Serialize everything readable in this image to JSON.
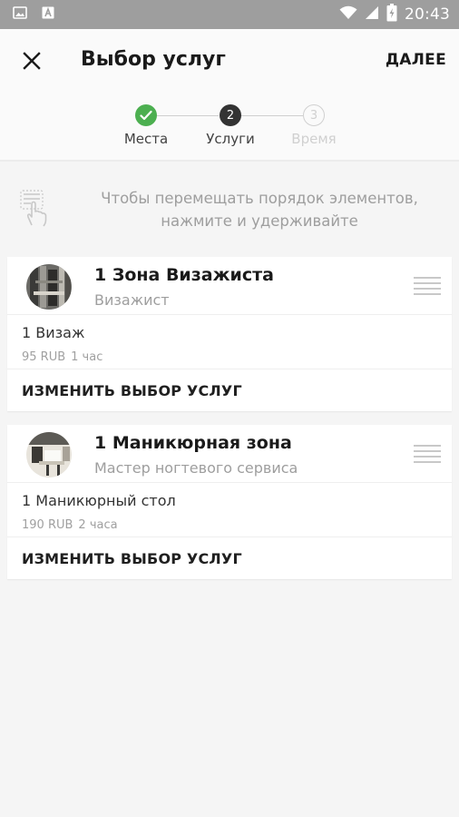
{
  "status_bar": {
    "time": "20:43",
    "icons": [
      "image-icon",
      "a-icon",
      "wifi-icon",
      "signal-icon",
      "battery-icon"
    ]
  },
  "app_bar": {
    "title": "Выбор услуг",
    "next_label": "ДАЛЕЕ",
    "close_icon": "close-icon"
  },
  "stepper": {
    "steps": [
      {
        "label": "Места",
        "number": "1",
        "state": "done"
      },
      {
        "label": "Услуги",
        "number": "2",
        "state": "active"
      },
      {
        "label": "Время",
        "number": "3",
        "state": "inactive"
      }
    ],
    "colors": {
      "done": "#4caf50",
      "active": "#333333",
      "inactive": "#d0d0d0"
    }
  },
  "hint": {
    "text_line1": "Чтобы перемещать порядок элементов,",
    "text_line2": "нажмите и удерживайте",
    "icon": "touch-hold-icon"
  },
  "cards": [
    {
      "title": "1 Зона Визажиста",
      "subtitle": "Визажист",
      "service_name": "1 Визаж",
      "price": "95 RUB",
      "duration": "1 час",
      "change_label": "ИЗМЕНИТЬ ВЫБОР УСЛУГ"
    },
    {
      "title": "1 Маникюрная зона",
      "subtitle": "Мастер ногтевого сервиса",
      "service_name": "1 Маникюрный стол",
      "price": "190 RUB",
      "duration": "2 часа",
      "change_label": "ИЗМЕНИТЬ ВЫБОР УСЛУГ"
    }
  ]
}
